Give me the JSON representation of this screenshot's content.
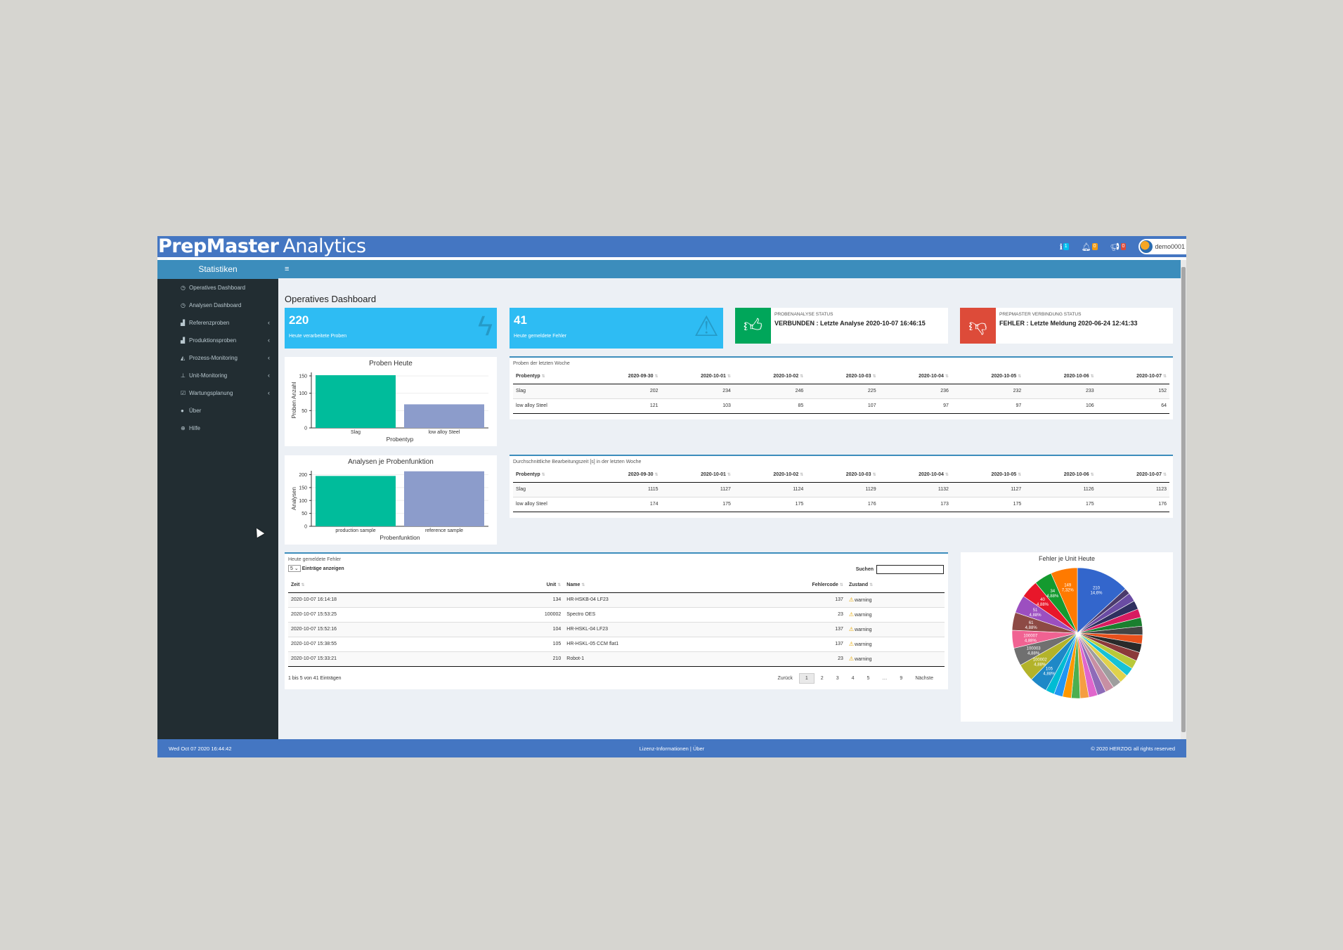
{
  "brand": {
    "part1": "PrepMaster",
    "part2": "Analytics"
  },
  "topnav": {
    "info_badge": "1",
    "bell_badge": "0",
    "flag_badge": "0",
    "username": "demo0001",
    "colors": {
      "info": "#00c0ef",
      "bell": "#f39c12",
      "flag": "#dd4b39"
    }
  },
  "sidebar": {
    "title": "Statistiken",
    "items": [
      {
        "label": "Operatives Dashboard",
        "icon": "dashboard-icon",
        "sub": false
      },
      {
        "label": "Analysen Dashboard",
        "icon": "dashboard-icon",
        "sub": false
      },
      {
        "label": "Referenzproben",
        "icon": "line-chart-icon",
        "sub": true
      },
      {
        "label": "Produktionsproben",
        "icon": "line-chart-icon",
        "sub": true
      },
      {
        "label": "Prozess-Monitoring",
        "icon": "area-chart-icon",
        "sub": true
      },
      {
        "label": "Unit-Monitoring",
        "icon": "sitemap-icon",
        "sub": true
      },
      {
        "label": "Wartungsplanung",
        "icon": "calendar-check-icon",
        "sub": true
      },
      {
        "label": "Über",
        "icon": "info-circle-icon",
        "sub": false
      },
      {
        "label": "Hilfe",
        "icon": "globe-icon",
        "sub": false
      }
    ]
  },
  "page_title": "Operatives Dashboard",
  "infoboxes": {
    "processed": {
      "value": "220",
      "label": "Heute verarbeitete Proben"
    },
    "errors": {
      "value": "41",
      "label": "Heute gemeldete Fehler"
    },
    "analysis_status": {
      "header": "PROBENANALYSE STATUS",
      "value": "VERBUNDEN : Letzte Analyse 2020-10-07 16:46:15",
      "color": "#00a65a"
    },
    "connection_status": {
      "header": "PREPMASTER VERBINDUNG STATUS",
      "value": "FEHLER : Letzte Meldung 2020-06-24 12:41:33",
      "color": "#dd4b39"
    }
  },
  "chart_data": [
    {
      "type": "bar",
      "title": "Proben Heute",
      "xlabel": "Probentyp",
      "ylabel": "Proben Anzahl",
      "categories": [
        "Slag",
        "low alloy Steel"
      ],
      "values": [
        152,
        68
      ],
      "ylim": [
        0,
        160
      ],
      "yticks": [
        0,
        50,
        100,
        150
      ],
      "colors": [
        "#00bc9b",
        "#8c9ccb"
      ]
    },
    {
      "type": "bar",
      "title": "Analysen je Probenfunktion",
      "xlabel": "Probenfunktion",
      "ylabel": "Analysen",
      "categories": [
        "production sample",
        "reference sample"
      ],
      "values": [
        195,
        213
      ],
      "ylim": [
        0,
        215
      ],
      "yticks": [
        0,
        50,
        100,
        150,
        200
      ],
      "colors": [
        "#00bc9b",
        "#8c9ccb"
      ]
    },
    {
      "type": "pie",
      "title": "Fehler je Unit Heute",
      "slices": [
        {
          "label": "210",
          "pct": "14,6%",
          "value": 14.6,
          "color": "#3366cc"
        },
        {
          "label": "",
          "pct": "",
          "value": 1.6,
          "color": "#4b3a6b"
        },
        {
          "label": "",
          "pct": "",
          "value": 2.4,
          "color": "#6a4ca3"
        },
        {
          "label": "",
          "pct": "",
          "value": 2.4,
          "color": "#2f2f5f"
        },
        {
          "label": "",
          "pct": "",
          "value": 2.4,
          "color": "#d81b60"
        },
        {
          "label": "",
          "pct": "",
          "value": 2.4,
          "color": "#1a7f2e"
        },
        {
          "label": "",
          "pct": "",
          "value": 2.4,
          "color": "#444444"
        },
        {
          "label": "",
          "pct": "",
          "value": 2.4,
          "color": "#e8501b"
        },
        {
          "label": "",
          "pct": "",
          "value": 2.4,
          "color": "#2a2a2a"
        },
        {
          "label": "",
          "pct": "",
          "value": 2.4,
          "color": "#8b3a3a"
        },
        {
          "label": "",
          "pct": "",
          "value": 2.4,
          "color": "#b9c93a"
        },
        {
          "label": "",
          "pct": "",
          "value": 2.4,
          "color": "#16c2d6"
        },
        {
          "label": "",
          "pct": "",
          "value": 2.4,
          "color": "#e0d24c"
        },
        {
          "label": "",
          "pct": "",
          "value": 2.4,
          "color": "#9e9e9e"
        },
        {
          "label": "",
          "pct": "",
          "value": 2.4,
          "color": "#c78fa3"
        },
        {
          "label": "",
          "pct": "",
          "value": 2.4,
          "color": "#8e6bb8"
        },
        {
          "label": "",
          "pct": "",
          "value": 2.4,
          "color": "#e066cc"
        },
        {
          "label": "",
          "pct": "",
          "value": 2.4,
          "color": "#f59e42"
        },
        {
          "label": "",
          "pct": "",
          "value": 2.4,
          "color": "#4caf50"
        },
        {
          "label": "",
          "pct": "",
          "value": 2.4,
          "color": "#ff9800"
        },
        {
          "label": "",
          "pct": "",
          "value": 2.4,
          "color": "#2196f3"
        },
        {
          "label": "",
          "pct": "",
          "value": 2.4,
          "color": "#00bcd4"
        },
        {
          "label": "105",
          "pct": "4,88%",
          "value": 4.9,
          "color": "#1e88c7"
        },
        {
          "label": "100002",
          "pct": "4,88%",
          "value": 4.9,
          "color": "#b3b32a"
        },
        {
          "label": "100003",
          "pct": "4,88%",
          "value": 4.9,
          "color": "#707070"
        },
        {
          "label": "100007",
          "pct": "4,88%",
          "value": 4.9,
          "color": "#f06292"
        },
        {
          "label": "61",
          "pct": "4,88%",
          "value": 4.9,
          "color": "#8d4a45"
        },
        {
          "label": "51",
          "pct": "4,88%",
          "value": 4.9,
          "color": "#9c4fc0"
        },
        {
          "label": "40",
          "pct": "4,88%",
          "value": 4.9,
          "color": "#e8172a"
        },
        {
          "label": "34",
          "pct": "4,88%",
          "value": 4.9,
          "color": "#149a2f"
        },
        {
          "label": "149",
          "pct": "7,32%",
          "value": 7.3,
          "color": "#ff7a00"
        }
      ]
    }
  ],
  "weekly_samples": {
    "title": "Proben der letzten Woche",
    "columns": [
      "Probentyp",
      "2020-09-30",
      "2020-10-01",
      "2020-10-02",
      "2020-10-03",
      "2020-10-04",
      "2020-10-05",
      "2020-10-06",
      "2020-10-07"
    ],
    "rows": [
      [
        "Slag",
        "202",
        "234",
        "246",
        "225",
        "236",
        "232",
        "233",
        "152"
      ],
      [
        "low alloy Steel",
        "121",
        "103",
        "85",
        "107",
        "97",
        "97",
        "106",
        "64"
      ]
    ]
  },
  "avg_time": {
    "title": "Durchschnittliche Bearbeitungszeit [s] in der letzten Woche",
    "columns": [
      "Probentyp",
      "2020-09-30",
      "2020-10-01",
      "2020-10-02",
      "2020-10-03",
      "2020-10-04",
      "2020-10-05",
      "2020-10-06",
      "2020-10-07"
    ],
    "rows": [
      [
        "Slag",
        "1115",
        "1127",
        "1124",
        "1129",
        "1132",
        "1127",
        "1126",
        "1123"
      ],
      [
        "low alloy Steel",
        "174",
        "175",
        "175",
        "176",
        "173",
        "175",
        "175",
        "176"
      ]
    ]
  },
  "errors_table": {
    "title": "Heute gemeldete Fehler",
    "length_value": "5",
    "length_label": "Einträge anzeigen",
    "search_label": "Suchen",
    "search_value": "",
    "columns": [
      "Zeit",
      "Unit",
      "Name",
      "Fehlercode",
      "Zustand"
    ],
    "rows": [
      [
        "2020-10-07 16:14:18",
        "134",
        "HR-HSKB-04 LF23",
        "137",
        "warning"
      ],
      [
        "2020-10-07 15:53:25",
        "100002",
        "Spectro OES",
        "23",
        "warning"
      ],
      [
        "2020-10-07 15:52:16",
        "104",
        "HR-HSKL-04 LF23",
        "137",
        "warning"
      ],
      [
        "2020-10-07 15:38:55",
        "105",
        "HR-HSKL-05 CCM flat1",
        "137",
        "warning"
      ],
      [
        "2020-10-07 15:33:21",
        "210",
        "Robot-1",
        "23",
        "warning"
      ]
    ],
    "info": "1 bis 5 von 41 Einträgen",
    "pager": [
      "Zurück",
      "1",
      "2",
      "3",
      "4",
      "5",
      "…",
      "9",
      "Nächste"
    ],
    "active_page": "1"
  },
  "footer": {
    "datetime": "Wed Oct 07 2020 16:44:42",
    "license": "Lizenz-Informationen",
    "sep": "|",
    "about": "Über",
    "copyright": "© 2020 HERZOG all rights reserved"
  }
}
